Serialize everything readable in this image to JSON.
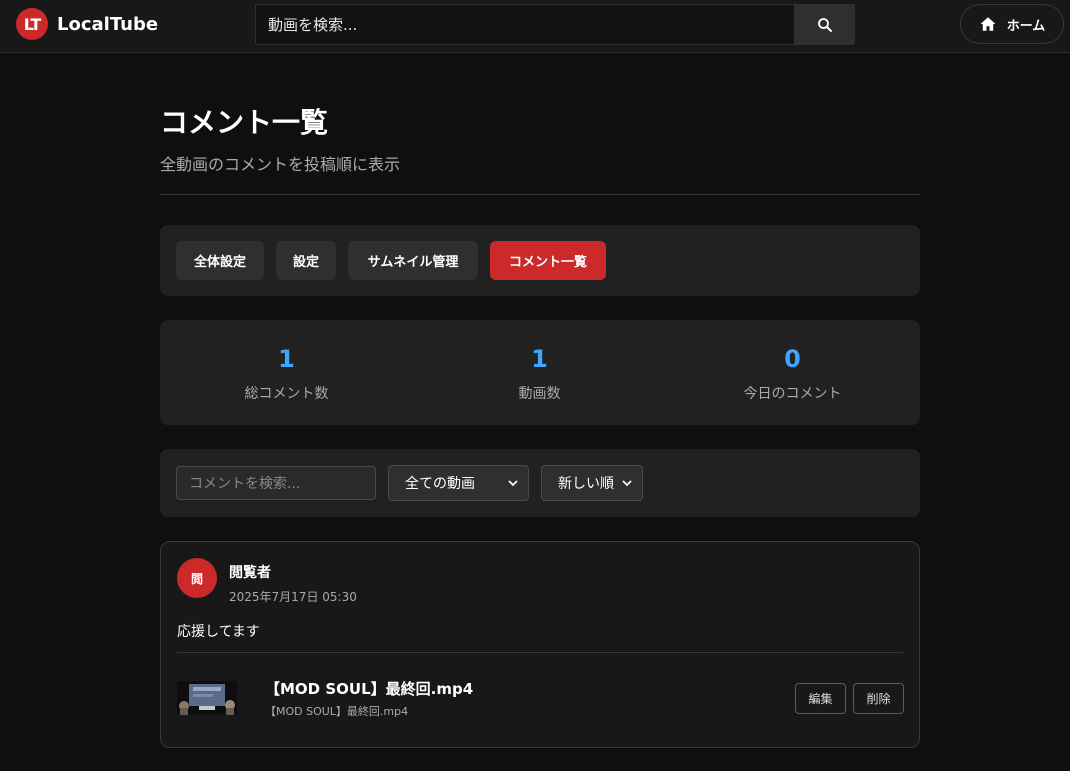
{
  "header": {
    "logo_mark": "LT",
    "logo_text": "LocalTube",
    "search_placeholder": "動画を検索...",
    "search_icon": "search-icon",
    "home_label": "ホーム",
    "home_icon": "home-icon"
  },
  "page": {
    "title": "コメント一覧",
    "subtitle": "全動画のコメントを投稿順に表示"
  },
  "nav": {
    "items": [
      {
        "label": "全体設定",
        "active": false
      },
      {
        "label": "設定",
        "active": false
      },
      {
        "label": "サムネイル管理",
        "active": false
      },
      {
        "label": "コメント一覧",
        "active": true
      }
    ]
  },
  "stats": [
    {
      "value": "1",
      "label": "総コメント数"
    },
    {
      "value": "1",
      "label": "動画数"
    },
    {
      "value": "0",
      "label": "今日のコメント"
    }
  ],
  "filters": {
    "search_placeholder": "コメントを検索...",
    "video_select": "全ての動画",
    "sort_select": "新しい順"
  },
  "comments": [
    {
      "avatar": "閲",
      "author": "閲覧者",
      "timestamp": "2025年7月17日 05:30",
      "text": "応援してます",
      "video_title": "【MOD SOUL】最終回.mp4",
      "video_file": "【MOD SOUL】最終回.mp4",
      "edit_label": "編集",
      "delete_label": "削除"
    }
  ],
  "colors": {
    "accent_red": "#cc2a2a",
    "stat_blue": "#3ea6ff",
    "background": "#0f0f0f",
    "panel": "#212121"
  }
}
